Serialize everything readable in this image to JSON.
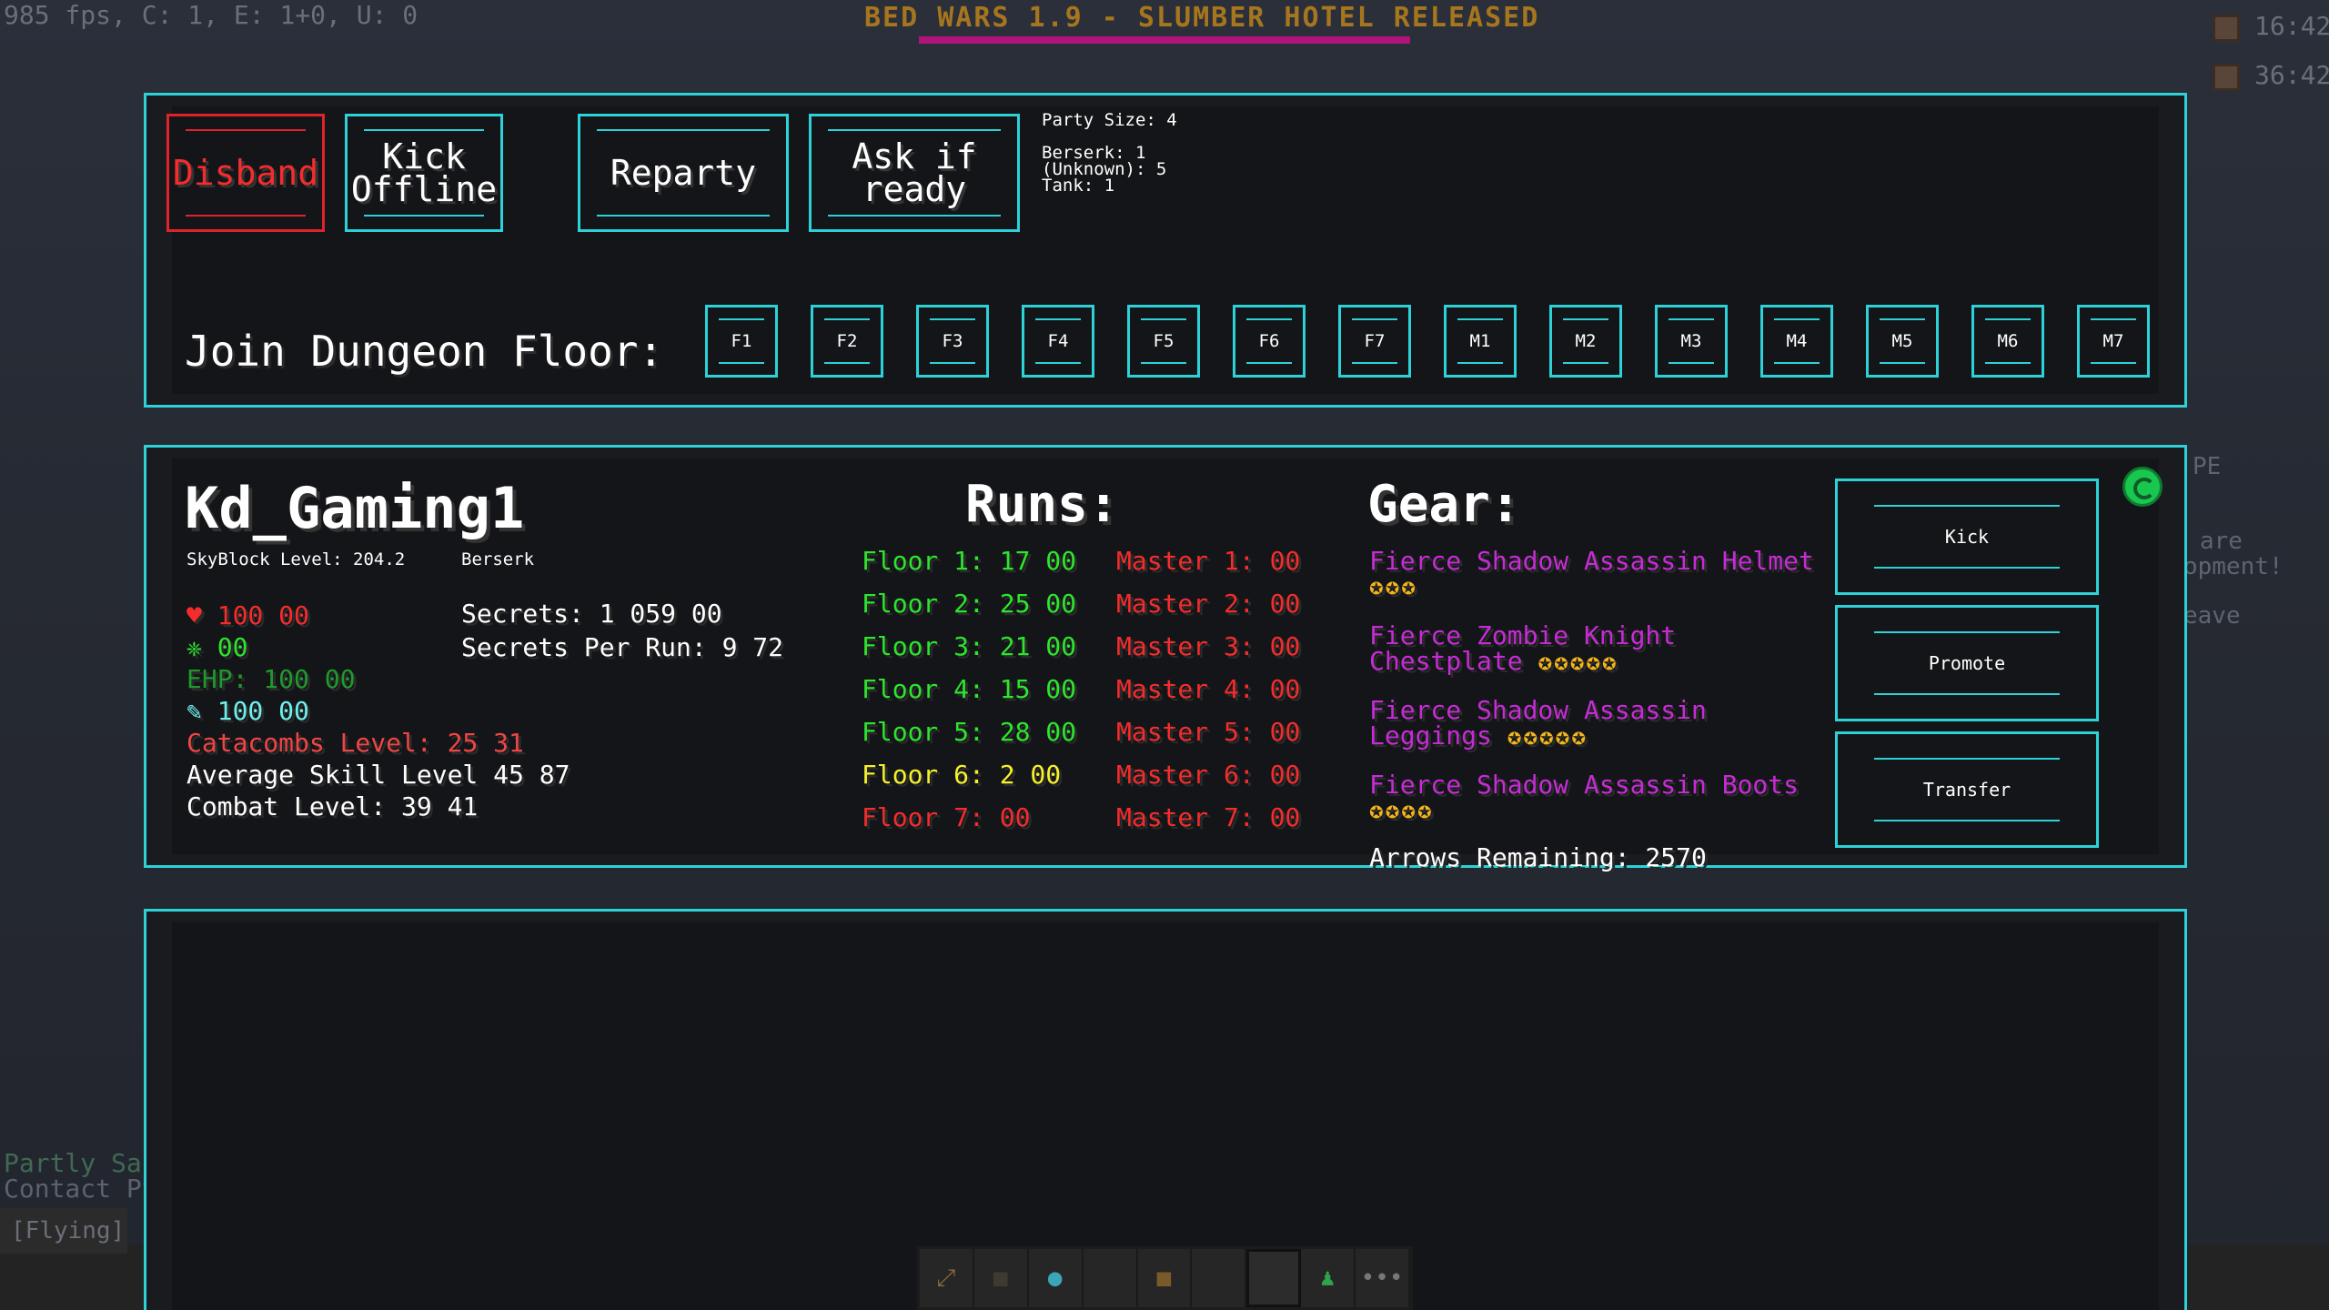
{
  "hud": {
    "fps": "985 fps, C: 1, E: 1+0, U: 0",
    "title": "BED WARS 1.9 - SLUMBER HOTEL RELEASED",
    "clock1": "16:42",
    "clock2": "36:42",
    "side_text": [
      "PE",
      "are",
      "opment!",
      "eave"
    ],
    "chat": [
      "Partly Sa",
      "Contact PS"
    ],
    "flying": "[Flying]"
  },
  "party": {
    "buttons": {
      "disband": "Disband",
      "kick_offline": "Kick\nOffline",
      "reparty": "Reparty",
      "ask_ready": "Ask if\nready"
    },
    "size": "Party Size: 4",
    "classes": [
      "Berserk: 1",
      "(Unknown): 5",
      "Tank: 1"
    ],
    "join_label": "Join Dungeon Floor:",
    "floors": [
      "F1",
      "F2",
      "F3",
      "F4",
      "F5",
      "F6",
      "F7",
      "M1",
      "M2",
      "M3",
      "M4",
      "M5",
      "M6",
      "M7"
    ]
  },
  "player": {
    "name": "Kd_Gaming1",
    "skyblock_level": "SkyBlock Level: 204.2",
    "class": "Berserk",
    "health": "100 00",
    "defense": "00",
    "ehp": "EHP: 100 00",
    "intelligence": "100 00",
    "catacombs": "Catacombs Level: 25 31",
    "avg_skill": "Average Skill Level 45 87",
    "combat": "Combat Level: 39 41",
    "secrets": "Secrets: 1 059 00",
    "secrets_per_run": "Secrets Per Run: 9 72"
  },
  "runs": {
    "heading": "Runs:",
    "floors": [
      {
        "label": "Floor 1: 17 00",
        "color": "#2ce52c"
      },
      {
        "label": "Floor 2: 25 00",
        "color": "#2ce52c"
      },
      {
        "label": "Floor 3: 21 00",
        "color": "#2ce52c"
      },
      {
        "label": "Floor 4: 15 00",
        "color": "#2ce52c"
      },
      {
        "label": "Floor 5: 28 00",
        "color": "#2ce52c"
      },
      {
        "label": "Floor 6: 2 00",
        "color": "#f6f02c"
      },
      {
        "label": "Floor 7:  00",
        "color": "#f42c2c"
      }
    ],
    "masters": [
      "Master 1:  00",
      "Master 2:  00",
      "Master 3:  00",
      "Master 4:  00",
      "Master 5:  00",
      "Master 6:  00",
      "Master 7:  00"
    ]
  },
  "gear": {
    "heading": "Gear:",
    "helmet": "Fierce Shadow Assassin Helmet",
    "helmet_stars": "✪✪✪",
    "chest_l1": "Fierce Zombie Knight",
    "chest_l2": "Chestplate",
    "chest_stars": "✪✪✪✪✪",
    "legs_l1": "Fierce Shadow Assassin",
    "legs_l2": "Leggings",
    "legs_stars": "✪✪✪✪✪",
    "boots": "Fierce Shadow Assassin Boots",
    "boots_stars": "✪✪✪✪",
    "arrows": "Arrows Remaining: 2570"
  },
  "actions": {
    "kick": "Kick",
    "promote": "Promote",
    "transfer": "Transfer"
  }
}
